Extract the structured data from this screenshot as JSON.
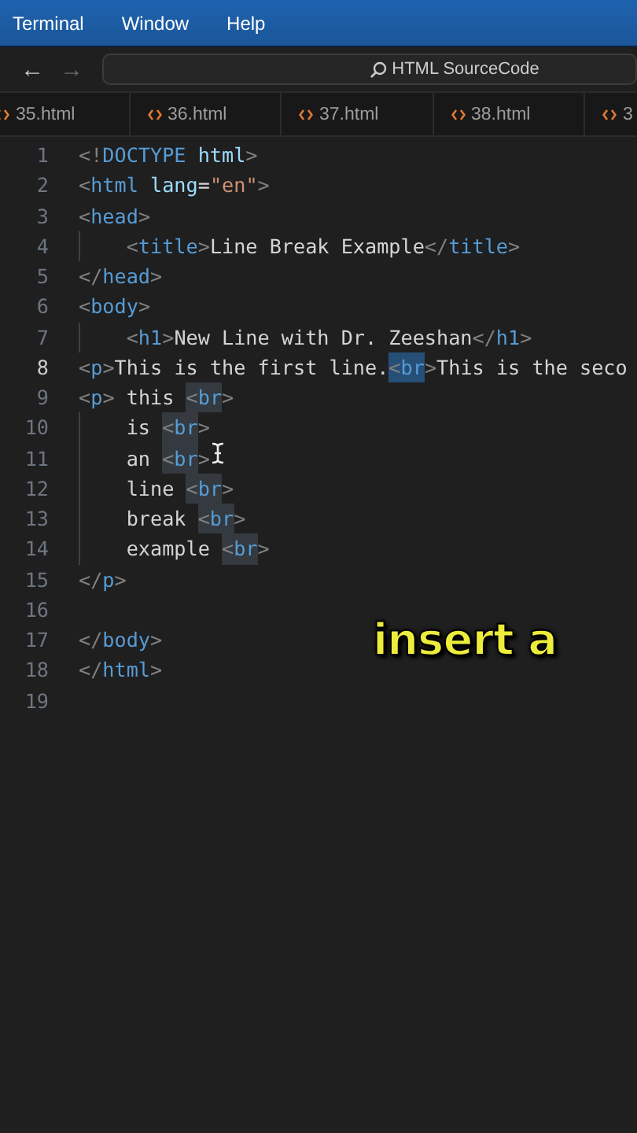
{
  "menu": [
    "Terminal",
    "Window",
    "Help"
  ],
  "toolbar": {
    "back": "←",
    "forward": "→",
    "search": "HTML SourceCode"
  },
  "tabs": [
    {
      "label": "35.html",
      "selected": false
    },
    {
      "label": "36.html",
      "selected": false
    },
    {
      "label": "37.html",
      "selected": false
    },
    {
      "label": "38.html",
      "selected": false
    },
    {
      "label": "3",
      "selected": false
    }
  ],
  "lines": [
    {
      "number": "1",
      "current": false,
      "indented": false,
      "tokens": [
        {
          "text": "<!",
          "kind": "punct"
        },
        {
          "text": "DOCTYPE",
          "kind": "tag"
        },
        {
          "text": " html",
          "kind": "attr"
        },
        {
          "text": ">",
          "kind": "punct"
        }
      ]
    },
    {
      "number": "2",
      "current": false,
      "indented": false,
      "tokens": [
        {
          "text": "<",
          "kind": "punct"
        },
        {
          "text": "html",
          "kind": "tag"
        },
        {
          "text": " lang",
          "kind": "attr"
        },
        {
          "text": "=",
          "kind": "text"
        },
        {
          "text": "\"en\"",
          "kind": "string"
        },
        {
          "text": ">",
          "kind": "punct"
        }
      ]
    },
    {
      "number": "3",
      "current": false,
      "indented": false,
      "tokens": [
        {
          "text": "<",
          "kind": "punct"
        },
        {
          "text": "head",
          "kind": "tag"
        },
        {
          "text": ">",
          "kind": "punct"
        }
      ]
    },
    {
      "number": "4",
      "current": false,
      "indented": true,
      "tokens": [
        {
          "text": "<",
          "kind": "punct"
        },
        {
          "text": "title",
          "kind": "tag"
        },
        {
          "text": ">",
          "kind": "punct"
        },
        {
          "text": "Line Break Example",
          "kind": "text"
        },
        {
          "text": "</",
          "kind": "punct"
        },
        {
          "text": "title",
          "kind": "tag"
        },
        {
          "text": ">",
          "kind": "punct"
        }
      ]
    },
    {
      "number": "5",
      "current": false,
      "indented": false,
      "tokens": [
        {
          "text": "</",
          "kind": "punct"
        },
        {
          "text": "head",
          "kind": "tag"
        },
        {
          "text": ">",
          "kind": "punct"
        }
      ]
    },
    {
      "number": "6",
      "current": false,
      "indented": false,
      "tokens": [
        {
          "text": "<",
          "kind": "punct"
        },
        {
          "text": "body",
          "kind": "tag"
        },
        {
          "text": ">",
          "kind": "punct"
        }
      ]
    },
    {
      "number": "7",
      "current": false,
      "indented": true,
      "tokens": [
        {
          "text": "<",
          "kind": "punct"
        },
        {
          "text": "h1",
          "kind": "tag"
        },
        {
          "text": ">",
          "kind": "punct"
        },
        {
          "text": "New Line with Dr. Zeeshan",
          "kind": "text"
        },
        {
          "text": "</",
          "kind": "punct"
        },
        {
          "text": "h1",
          "kind": "tag"
        },
        {
          "text": ">",
          "kind": "punct"
        }
      ]
    },
    {
      "number": "8",
      "current": true,
      "indented": false,
      "tokens": [
        {
          "text": "<",
          "kind": "punct"
        },
        {
          "text": "p",
          "kind": "tag"
        },
        {
          "text": ">",
          "kind": "punct"
        },
        {
          "text": "This is the first line.",
          "kind": "text"
        },
        {
          "kind": "selection",
          "tokens": [
            {
              "text": "<",
              "kind": "punct"
            },
            {
              "text": "br",
              "kind": "tag"
            }
          ]
        },
        {
          "text": ">",
          "kind": "punct"
        },
        {
          "text": "This is the seco",
          "kind": "text"
        }
      ]
    },
    {
      "number": "9",
      "current": false,
      "indented": false,
      "tokens": [
        {
          "text": "<",
          "kind": "punct"
        },
        {
          "text": "p",
          "kind": "tag"
        },
        {
          "text": ">",
          "kind": "punct"
        },
        {
          "text": " this ",
          "kind": "text"
        },
        {
          "kind": "occurrence",
          "tokens": [
            {
              "text": "<",
              "kind": "punct"
            },
            {
              "text": "br",
              "kind": "tag"
            }
          ]
        },
        {
          "text": ">",
          "kind": "punct"
        }
      ]
    },
    {
      "number": "10",
      "current": false,
      "indented": true,
      "tokens": [
        {
          "text": "is ",
          "kind": "text"
        },
        {
          "kind": "occurrence",
          "tokens": [
            {
              "text": "<",
              "kind": "punct"
            },
            {
              "text": "br",
              "kind": "tag"
            }
          ]
        },
        {
          "text": ">",
          "kind": "punct"
        }
      ]
    },
    {
      "number": "11",
      "current": false,
      "indented": true,
      "tokens": [
        {
          "text": "an ",
          "kind": "text"
        },
        {
          "kind": "occurrence",
          "tokens": [
            {
              "text": "<",
              "kind": "punct"
            },
            {
              "text": "br",
              "kind": "tag"
            }
          ]
        },
        {
          "text": ">",
          "kind": "punct"
        }
      ]
    },
    {
      "number": "12",
      "current": false,
      "indented": true,
      "tokens": [
        {
          "text": "line ",
          "kind": "text"
        },
        {
          "kind": "occurrence",
          "tokens": [
            {
              "text": "<",
              "kind": "punct"
            },
            {
              "text": "br",
              "kind": "tag"
            }
          ]
        },
        {
          "text": ">",
          "kind": "punct"
        }
      ]
    },
    {
      "number": "13",
      "current": false,
      "indented": true,
      "tokens": [
        {
          "text": "break ",
          "kind": "text"
        },
        {
          "kind": "occurrence",
          "tokens": [
            {
              "text": "<",
              "kind": "punct"
            },
            {
              "text": "br",
              "kind": "tag"
            }
          ]
        },
        {
          "text": ">",
          "kind": "punct"
        }
      ]
    },
    {
      "number": "14",
      "current": false,
      "indented": true,
      "tokens": [
        {
          "text": "example ",
          "kind": "text"
        },
        {
          "kind": "occurrence",
          "tokens": [
            {
              "text": "<",
              "kind": "punct"
            },
            {
              "text": "br",
              "kind": "tag"
            }
          ]
        },
        {
          "text": ">",
          "kind": "punct"
        }
      ]
    },
    {
      "number": "15",
      "current": false,
      "indented": false,
      "tokens": [
        {
          "text": "</",
          "kind": "punct"
        },
        {
          "text": "p",
          "kind": "tag"
        },
        {
          "text": ">",
          "kind": "punct"
        }
      ]
    },
    {
      "number": "16",
      "current": false,
      "indented": false
    },
    {
      "number": "17",
      "current": false,
      "indented": false,
      "tokens": [
        {
          "text": "</",
          "kind": "punct"
        },
        {
          "text": "body",
          "kind": "tag"
        },
        {
          "text": ">",
          "kind": "punct"
        }
      ]
    },
    {
      "number": "18",
      "current": false,
      "indented": false,
      "tokens": [
        {
          "text": "</",
          "kind": "punct"
        },
        {
          "text": "html",
          "kind": "tag"
        },
        {
          "text": ">",
          "kind": "punct"
        }
      ]
    },
    {
      "number": "19",
      "current": false,
      "indented": false
    }
  ],
  "caption": "insert a"
}
